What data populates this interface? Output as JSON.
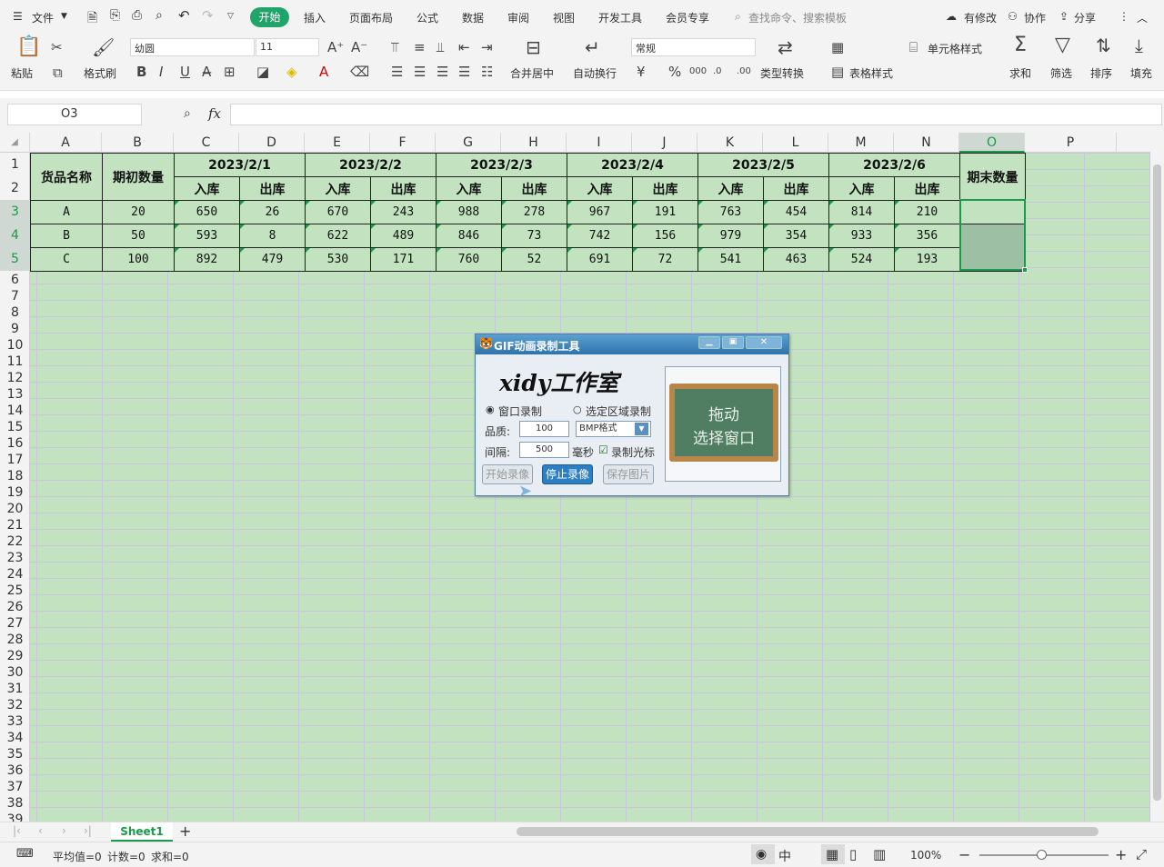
{
  "menu": {
    "file": "文件",
    "tabs": [
      "开始",
      "插入",
      "页面布局",
      "公式",
      "数据",
      "审阅",
      "视图",
      "开发工具",
      "会员专享"
    ],
    "search": "查找命令、搜索模板",
    "right": [
      "有修改",
      "协作",
      "分享"
    ]
  },
  "ribbon": {
    "paste": "粘贴",
    "format_painter": "格式刷",
    "font": "幼圆",
    "size": "11",
    "merge": "合并居中",
    "wrap": "自动换行",
    "number_format": "常规",
    "convert": "类型转换",
    "cell_style": "单元格样式",
    "table_style": "表格样式",
    "sum": "求和",
    "filter": "筛选",
    "sort": "排序",
    "fill": "填充"
  },
  "formula": {
    "cell_ref": "O3",
    "fx": "fx",
    "value": ""
  },
  "columns": [
    "A",
    "B",
    "C",
    "D",
    "E",
    "F",
    "G",
    "H",
    "I",
    "J",
    "K",
    "L",
    "M",
    "N",
    "O",
    "P"
  ],
  "rows": [
    "1",
    "2",
    "3",
    "4",
    "5",
    "6",
    "7",
    "8",
    "9",
    "10",
    "11",
    "12",
    "13",
    "14",
    "15",
    "16",
    "17",
    "18",
    "19",
    "20",
    "21",
    "22",
    "23",
    "24",
    "25",
    "26",
    "27",
    "28",
    "29",
    "30",
    "31",
    "32",
    "33",
    "34",
    "35",
    "36",
    "37",
    "38",
    "39"
  ],
  "table": {
    "h_name": "货品名称",
    "h_init": "期初数量",
    "h_end": "期末数量",
    "dates": [
      "2023/2/1",
      "2023/2/2",
      "2023/2/3",
      "2023/2/4",
      "2023/2/5",
      "2023/2/6"
    ],
    "in": "入库",
    "out": "出库",
    "rows": [
      {
        "name": "A",
        "init": "20",
        "vals": [
          "650",
          "26",
          "670",
          "243",
          "988",
          "278",
          "967",
          "191",
          "763",
          "454",
          "814",
          "210"
        ]
      },
      {
        "name": "B",
        "init": "50",
        "vals": [
          "593",
          "8",
          "622",
          "489",
          "846",
          "73",
          "742",
          "156",
          "979",
          "354",
          "933",
          "356"
        ]
      },
      {
        "name": "C",
        "init": "100",
        "vals": [
          "892",
          "479",
          "530",
          "171",
          "760",
          "52",
          "691",
          "72",
          "541",
          "463",
          "524",
          "193"
        ]
      }
    ]
  },
  "dialog": {
    "title": "GIF动画录制工具",
    "brand": "xidy工作室",
    "radio1": "窗口录制",
    "radio2": "选定区域录制",
    "quality_label": "品质:",
    "quality": "100",
    "format": "BMP格式",
    "interval_label": "间隔:",
    "interval": "500",
    "ms": "毫秒",
    "cursor": "录制光标",
    "start": "开始录像",
    "stop": "停止录像",
    "save": "保存图片",
    "board1": "拖动",
    "board2": "选择窗口"
  },
  "sheet_tab": "Sheet1",
  "status": {
    "avg": "平均值=0",
    "count": "计数=0",
    "sum": "求和=0",
    "zoom": "100%"
  }
}
